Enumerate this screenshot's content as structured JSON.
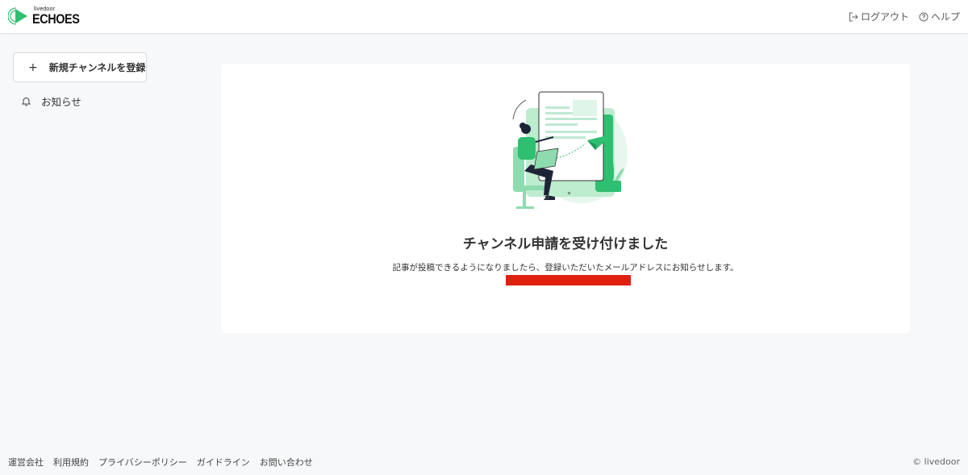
{
  "header": {
    "logo_sub": "livedoor",
    "logo_main": "ECHOES",
    "logout_label": "ログアウト",
    "help_label": "ヘルプ"
  },
  "sidebar": {
    "register_label": "新規チャンネルを登録",
    "notice_label": "お知らせ"
  },
  "main": {
    "title": "チャンネル申請を受け付けました",
    "message": "記事が投稿できるようになりましたら、登録いただいたメールアドレスにお知らせします。"
  },
  "footer": {
    "links": [
      "運営会社",
      "利用規約",
      "プライバシーポリシー",
      "ガイドライン",
      "お問い合わせ"
    ],
    "copyright": "© livedoor"
  },
  "colors": {
    "accent": "#2fbf71",
    "accent_light": "#c8f0da",
    "redaction": "#e0200f"
  }
}
